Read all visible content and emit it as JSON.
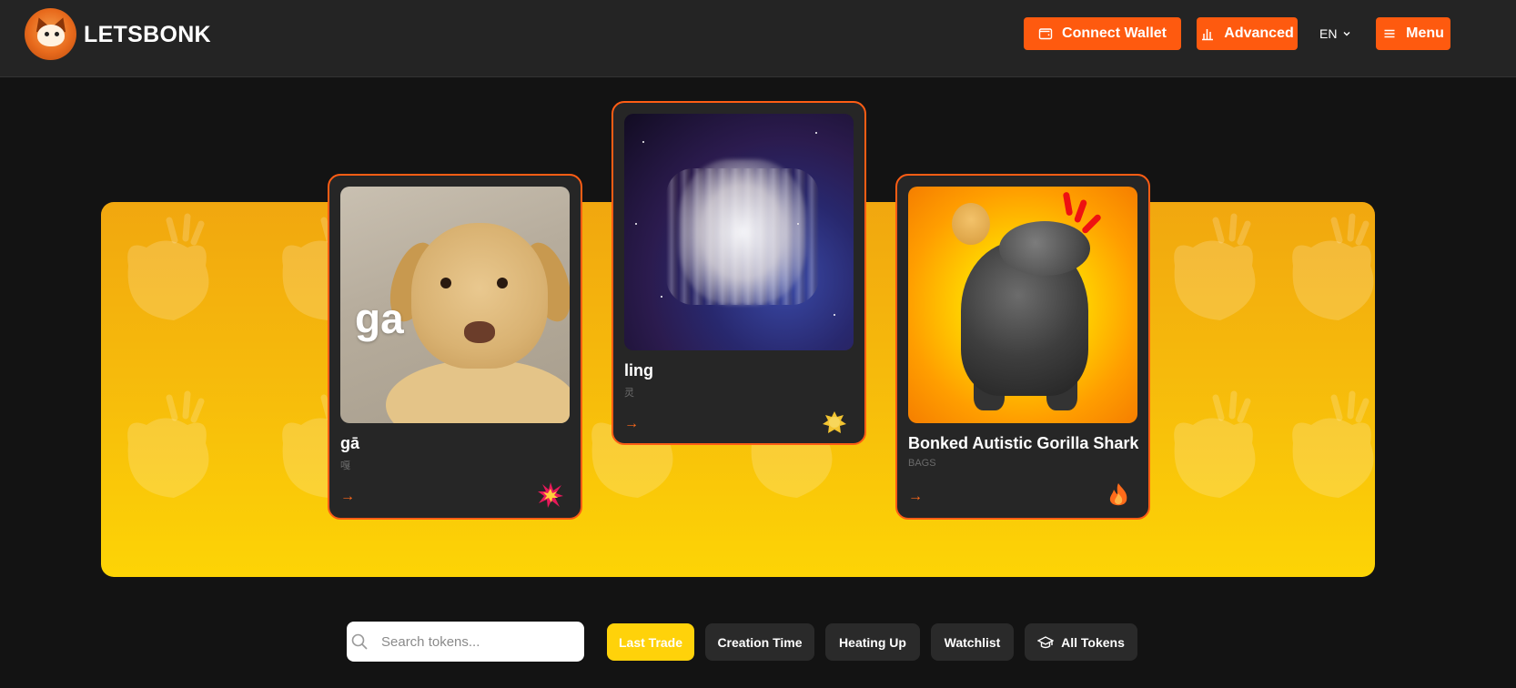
{
  "header": {
    "brand": "LETSBONK",
    "connect_wallet": "Connect Wallet",
    "advanced": "Advanced",
    "language": "EN",
    "menu": "Menu",
    "accent_color": "#fe5a0f"
  },
  "featured": [
    {
      "title": "gā",
      "subtitle": "嘎",
      "art_text": "ga",
      "badge": "explosion-icon"
    },
    {
      "title": "ling",
      "subtitle": "灵",
      "badge": "splat-icon"
    },
    {
      "title": "Bonked Autistic Gorilla Shark",
      "subtitle": "BAGS",
      "badge": "fire-icon"
    }
  ],
  "arrow_glyph": "→",
  "search": {
    "placeholder": "Search tokens..."
  },
  "filters": [
    {
      "label": "Last Trade",
      "active": true
    },
    {
      "label": "Creation Time",
      "active": false
    },
    {
      "label": "Heating Up",
      "active": false
    },
    {
      "label": "Watchlist",
      "active": false
    },
    {
      "label": "All Tokens",
      "active": false,
      "icon": "graduation-cap-icon"
    }
  ]
}
